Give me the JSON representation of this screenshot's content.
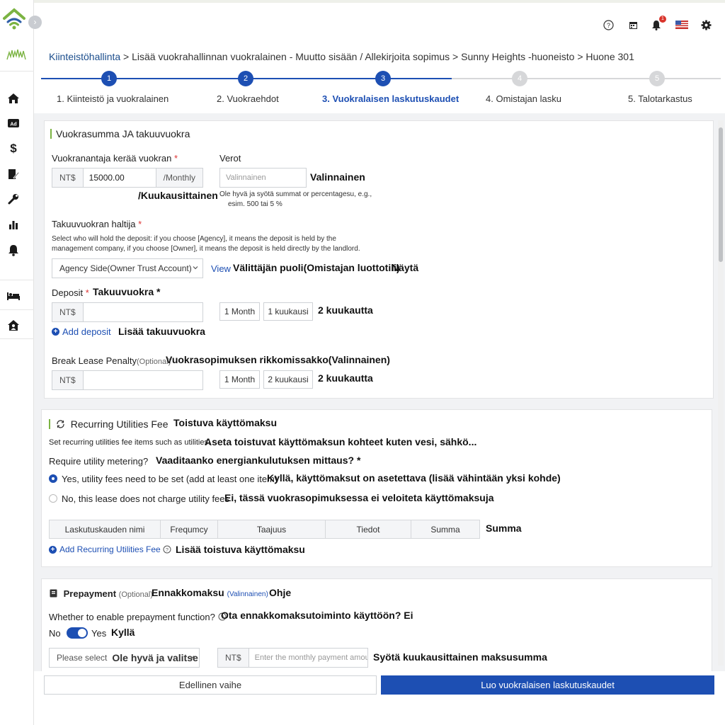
{
  "topbar": {
    "icons": [
      "help-icon",
      "calendar-icon",
      "bell-icon",
      "flag-icon",
      "gear-icon"
    ],
    "notification_count": "1"
  },
  "breadcrumb": {
    "first": "Kiinteistöhallinta",
    "rest": " > Lisää vuokrahallinnan vuokralainen - Muutto sisään / Allekirjoita sopimus > Sunny Heights -huoneisto > Huone 301"
  },
  "stepper": {
    "steps": [
      {
        "number": "1",
        "label": "1. Kiinteistö ja vuokralainen"
      },
      {
        "number": "2",
        "label": "2. Vuokraehdot"
      },
      {
        "number": "3",
        "label": "3. Vuokralaisen laskutuskaudet"
      },
      {
        "number": "4",
        "label": "4. Omistajan lasku"
      },
      {
        "number": "5",
        "label": "5. Talotarkastus"
      }
    ],
    "active_index": 2
  },
  "rent_section": {
    "title": "Vuokrasumma JA takuuvuokra",
    "landlord_collects_label": "Vuokranantaja kerää vuokran",
    "currency": "NT$",
    "rent_value": "15000.00",
    "period_unit": "/Monthly",
    "period_unit_translation": "/Kuukausittainen",
    "tax_label": "Verot",
    "tax_placeholder": "Valinnainen",
    "tax_placeholder_translation": "Valinnainen",
    "tax_hint_line1": "Ole hyvä ja syötä summat or percentagesu, e.g.,",
    "tax_hint_line2": "esim. 500 tai 5 %",
    "deposit_holder_label": "Takuuvuokran haltija",
    "deposit_holder_help_line1": "Select who will hold the deposit: if you choose [Agency], it means the deposit is held by the",
    "deposit_holder_help_line2": "management company, if you choose [Owner], it means the deposit is held directly by the landlord.",
    "deposit_holder_value": "Agency Side(Owner Trust Account)",
    "view_link": "View",
    "deposit_holder_translation": "Välittäjän puoli(Omistajan luottotili)",
    "view_translation": "Näytä",
    "deposit_label": "Deposit",
    "deposit_translation": "Takuuvuokra *",
    "deposit_btn_1": "1 Month",
    "deposit_btn_2": "1 kuukausi",
    "deposit_btn_3_translation": "2 kuukautta",
    "add_deposit": "Add deposit",
    "add_deposit_translation": "Lisää takuuvuokra",
    "break_lease_label": "Break Lease Penalty",
    "break_lease_optional": "(Optional)",
    "break_lease_translation": "Vuokrasopimuksen rikkomissakko(Valinnainen)",
    "break_btn_1": "1 Month",
    "break_btn_2": "2 kuukausi",
    "break_btn_3_translation": "2 kuukautta"
  },
  "utilities_section": {
    "title": "Recurring Utilities Fee",
    "title_translation": "Toistuva käyttömaksu",
    "desc": "Set recurring utilities fee items such as utilities.",
    "desc_translation": "Aseta toistuvat käyttömaksun kohteet kuten vesi, sähkö...",
    "metering_label": "Require utility metering?",
    "metering_translation": "Vaaditaanko energiankulutuksen mittaus? *",
    "option_yes": "Yes, utility fees need to be set (add at least one item)",
    "option_yes_translation": "Kyllä, käyttömaksut on asetettava (lisää vähintään yksi kohde)",
    "option_no": "No, this lease does not charge utility fees",
    "option_no_translation": "Ei, tässä vuokrasopimuksessa ei veloiteta käyttömaksuja",
    "columns": [
      "Laskutuskauden nimi",
      "Frequmcy",
      "Taajuus",
      "Tiedot",
      "Summa"
    ],
    "column_translation": "Summa",
    "add_fee": "Add Recurring Utilities Fee",
    "add_fee_translation": "Lisää toistuva käyttömaksu"
  },
  "prepayment_section": {
    "title": "Prepayment",
    "optional": "(Optional)",
    "title_translation": "Ennakkomaksu",
    "optional_translation": "(Valinnainen)",
    "help_translation": "Ohje",
    "enable_label": "Whether to enable prepayment function?",
    "enable_translation": "Ota ennakkomaksutoiminto käyttöön? Ei",
    "toggle_no": "No",
    "toggle_yes": "Yes",
    "toggle_yes_translation": "Kyllä",
    "toggle_enabled": true,
    "select_placeholder": "Please select",
    "select_translation": "Ole hyvä ja valitse",
    "currency": "NT$",
    "amount_placeholder": "Enter the monthly payment amour",
    "amount_translation": "Syötä kuukausittainen maksusumma"
  },
  "footer": {
    "prev_label": "Edellinen vaihe",
    "submit_label": "Luo vuokralaisen laskutuskaudet"
  },
  "colors": {
    "primary": "#1d4fb3",
    "accent_green": "#7bb342",
    "required_red": "#d33"
  }
}
